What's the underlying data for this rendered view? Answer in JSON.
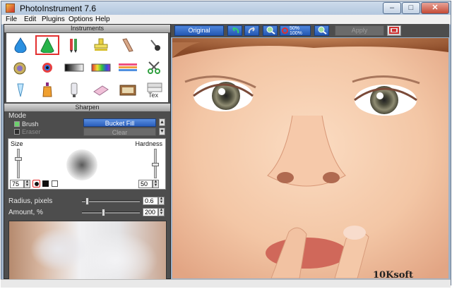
{
  "window": {
    "title": "PhotoInstrument 7.6",
    "controls": {
      "minimize": "–",
      "maximize": "□",
      "close": "✕"
    }
  },
  "menu": [
    "File",
    "Edit",
    "Plugins",
    "Options",
    "Help"
  ],
  "instruments": {
    "header": "Instruments",
    "tools": [
      "drop-icon",
      "cone-icon",
      "pencils-icon",
      "stamp-icon",
      "ruler-icon",
      "pin-icon",
      "bomb-icon",
      "eye-icon",
      "gradient-bar-icon",
      "rainbow-bar-icon",
      "spectrum-icon",
      "scissors-icon",
      "dropper-icon",
      "bottle-icon",
      "tube-icon",
      "eraser-icon",
      "album-icon",
      "text-stack-icon"
    ],
    "selected": "cone-icon"
  },
  "sharpen": {
    "header": "Sharpen",
    "mode_label": "Mode",
    "brush_label": "Brush",
    "eraser_label": "Eraser",
    "bucket_fill": "Bucket Fill",
    "clear": "Clear",
    "size_label": "Size",
    "hardness_label": "Hardness",
    "size_value": "75",
    "hardness_value": "50",
    "radius_label": "Radius, pixels",
    "radius_value": "0.6",
    "amount_label": "Amount, %",
    "amount_value": "200",
    "radius_level": 0.06,
    "amount_level": 0.36
  },
  "toolbar": {
    "original": "Original",
    "zoom_top": "50%",
    "zoom_bottom": "100%",
    "apply": "Apply"
  },
  "watermark": "10Ksoft"
}
